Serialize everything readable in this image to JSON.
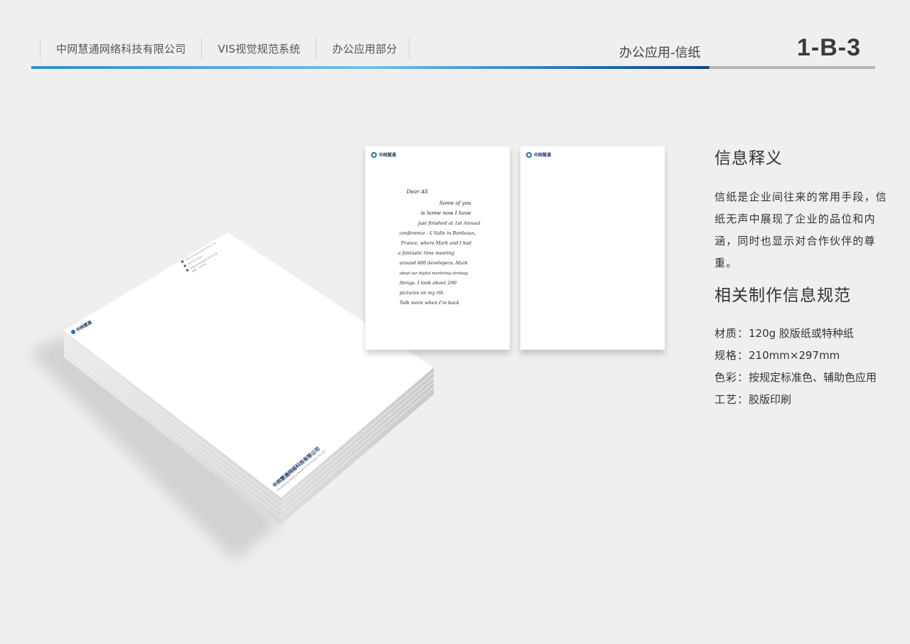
{
  "header": {
    "crumbs": [
      "中网慧通网络科技有限公司",
      "VIS视觉规范系统",
      "办公应用部分"
    ],
    "page_subtitle": "办公应用-信纸",
    "page_number": "1-B-3"
  },
  "mockup": {
    "brand_short": "中网慧通",
    "company_full_cn": "中网慧通网络科技有限公司",
    "company_full_en": "Zhongwang Huitong Network Technology Co.,Ltd",
    "contact_lines": [
      "www.zhongwanghuitong.com",
      "400-000-0000",
      "中国北京市海淀区中关村大街",
      "邮编：100000"
    ]
  },
  "letter": {
    "handwriting": [
      "Dear All",
      "Some of you",
      "is home now I have",
      "just finished at 1st Annual",
      "conference - L'Salle in Bordeaux,",
      "France, where Mark and I had",
      "a fantastic time meeting",
      "around 600 developers. Mark",
      "about our digital marketing strategy",
      "things. I took about 200",
      "pictures on my rib.",
      "Talk more when I'm back"
    ]
  },
  "info": {
    "meaning_title": "信息释义",
    "meaning_text": "信纸是企业间往来的常用手段，信纸无声中展现了企业的品位和内涵，同时也显示对合作伙伴的尊重。",
    "spec_title": "相关制作信息规范",
    "specs": [
      {
        "label": "材质：",
        "value": "120g 胶版纸或特种纸"
      },
      {
        "label": "规格：",
        "value": "210mm×297mm"
      },
      {
        "label": "色彩：",
        "value": "按规定标准色、辅助色应用"
      },
      {
        "label": "工艺：",
        "value": "胶版印刷"
      }
    ]
  },
  "colors": {
    "background": "#eeefee",
    "brand_blue": "#1f6fb8",
    "rule_gray": "#b4b6b8"
  }
}
